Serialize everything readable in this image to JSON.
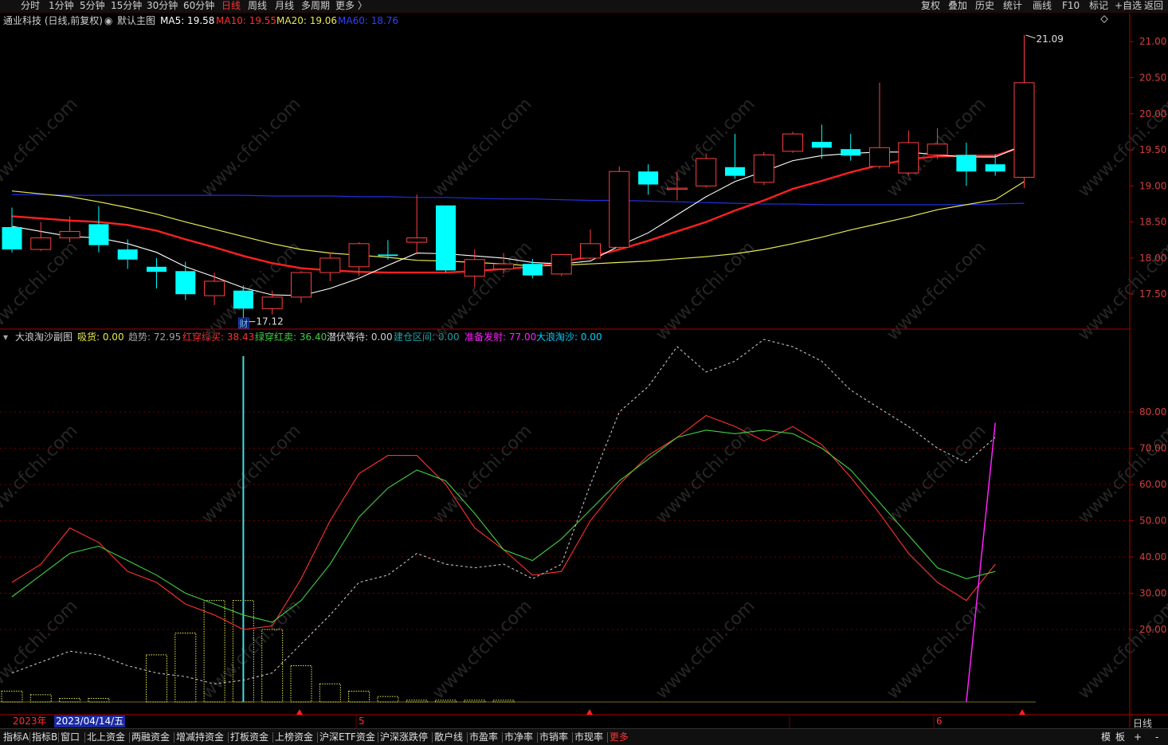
{
  "topbar": {
    "periods": [
      "分时",
      "1分钟",
      "5分钟",
      "15分钟",
      "30分钟",
      "60分钟",
      "日线",
      "周线",
      "月线",
      "多周期",
      "更多 〉"
    ],
    "active_period": "日线",
    "tools": [
      "复权",
      "叠加",
      "历史",
      "统计",
      "画线",
      "F10",
      "标记",
      "+自选",
      "返回"
    ]
  },
  "main_info": {
    "stock": "通业科技 (日线,前复权)",
    "indicator": "默认主图",
    "ma5": "MA5: 19.58",
    "ma10": "MA10: 19.55",
    "ma20": "MA20: 19.06",
    "ma60": "MA60: 18.76"
  },
  "sub_info": {
    "name": "大浪淘沙副图",
    "xihuo": "吸货: 0.00",
    "qushi": "趋势: 72.95",
    "hongchuan": "红穿绿买: 38.43",
    "lvchuan": "绿穿红卖: 36.40",
    "qianfu": "潜伏等待: 0.00",
    "jiancang": "建仓区间: 0.00",
    "zhunbei": "准备发射: 77.00",
    "dalang": "大浪淘沙: 0.00"
  },
  "colors": {
    "up": "#ff4040",
    "down": "#00ffff",
    "ma5": "#ffffff",
    "ma10": "#ff2020",
    "ma20": "#e8e850",
    "ma60": "#2030e0",
    "axis": "#b00000"
  },
  "price_axis": [
    "21.00",
    "20.50",
    "20.00",
    "19.50",
    "19.00",
    "18.50",
    "18.00",
    "17.50"
  ],
  "sub_axis": [
    "80.00",
    "70.00",
    "60.00",
    "50.00",
    "40.00",
    "30.00",
    "20.00"
  ],
  "annotations": {
    "high": "21.09",
    "low": "17.12",
    "cai": "财"
  },
  "date_bar": {
    "year": "2023年",
    "cursor_date": "2023/04/14/五",
    "month5": "5",
    "month6": "6"
  },
  "axis_label": "日线",
  "bottom_tabs": [
    "指标A",
    "指标B",
    "窗口",
    "北上资金",
    "两融资金",
    "增减持资金",
    "打板资金",
    "上榜资金",
    "沪深ETF资金",
    "沪深涨跌停",
    "散户线",
    "市盈率",
    "市净率",
    "市销率",
    "市现率",
    "更多"
  ],
  "bottom_right": [
    "模",
    "板",
    "+",
    "-"
  ],
  "watermark": "www.cfchi.com",
  "chart_data": [
    {
      "type": "candlestick",
      "title": "通业科技 (日线,前复权)",
      "ylim": [
        17.05,
        21.3
      ],
      "candles": [
        {
          "o": 18.43,
          "c": 18.12,
          "h": 18.7,
          "l": 18.08
        },
        {
          "o": 18.12,
          "c": 18.28,
          "h": 18.5,
          "l": 18.1
        },
        {
          "o": 18.28,
          "c": 18.37,
          "h": 18.58,
          "l": 18.22
        },
        {
          "o": 18.47,
          "c": 18.18,
          "h": 18.72,
          "l": 18.08
        },
        {
          "o": 18.12,
          "c": 17.98,
          "h": 18.26,
          "l": 17.85
        },
        {
          "o": 17.88,
          "c": 17.81,
          "h": 18.0,
          "l": 17.58
        },
        {
          "o": 17.82,
          "c": 17.5,
          "h": 17.95,
          "l": 17.42
        },
        {
          "o": 17.48,
          "c": 17.68,
          "h": 17.8,
          "l": 17.35
        },
        {
          "o": 17.55,
          "c": 17.3,
          "h": 17.62,
          "l": 17.12
        },
        {
          "o": 17.3,
          "c": 17.46,
          "h": 17.55,
          "l": 17.22
        },
        {
          "o": 17.46,
          "c": 17.8,
          "h": 17.82,
          "l": 17.38
        },
        {
          "o": 17.8,
          "c": 18.0,
          "h": 18.08,
          "l": 17.68
        },
        {
          "o": 17.88,
          "c": 18.2,
          "h": 18.22,
          "l": 17.75
        },
        {
          "o": 18.05,
          "c": 18.03,
          "h": 18.25,
          "l": 17.98
        },
        {
          "o": 18.22,
          "c": 18.28,
          "h": 18.88,
          "l": 18.05
        },
        {
          "o": 18.73,
          "c": 17.83,
          "h": 18.73,
          "l": 17.8
        },
        {
          "o": 17.75,
          "c": 17.98,
          "h": 18.12,
          "l": 17.6
        },
        {
          "o": 17.85,
          "c": 17.92,
          "h": 18.07,
          "l": 17.78
        },
        {
          "o": 17.92,
          "c": 17.76,
          "h": 17.99,
          "l": 17.72
        },
        {
          "o": 17.78,
          "c": 18.05,
          "h": 18.06,
          "l": 17.75
        },
        {
          "o": 18.0,
          "c": 18.2,
          "h": 18.4,
          "l": 17.98
        },
        {
          "o": 18.15,
          "c": 19.2,
          "h": 19.27,
          "l": 18.13
        },
        {
          "o": 19.2,
          "c": 19.02,
          "h": 19.3,
          "l": 18.88
        },
        {
          "o": 18.97,
          "c": 18.97,
          "h": 19.2,
          "l": 18.8
        },
        {
          "o": 19.0,
          "c": 19.38,
          "h": 19.45,
          "l": 18.98
        },
        {
          "o": 19.26,
          "c": 19.14,
          "h": 19.72,
          "l": 19.1
        },
        {
          "o": 19.05,
          "c": 19.43,
          "h": 19.47,
          "l": 19.01
        },
        {
          "o": 19.48,
          "c": 19.72,
          "h": 19.75,
          "l": 19.46
        },
        {
          "o": 19.61,
          "c": 19.53,
          "h": 19.85,
          "l": 19.38
        },
        {
          "o": 19.51,
          "c": 19.42,
          "h": 19.72,
          "l": 19.35
        },
        {
          "o": 19.27,
          "c": 19.53,
          "h": 20.43,
          "l": 19.24
        },
        {
          "o": 19.18,
          "c": 19.6,
          "h": 19.77,
          "l": 19.15
        },
        {
          "o": 19.43,
          "c": 19.58,
          "h": 19.8,
          "l": 19.37
        },
        {
          "o": 19.43,
          "c": 19.2,
          "h": 19.6,
          "l": 19.0
        },
        {
          "o": 19.3,
          "c": 19.2,
          "h": 19.44,
          "l": 19.14
        },
        {
          "o": 19.12,
          "c": 20.43,
          "h": 21.09,
          "l": 18.97
        }
      ],
      "ma5": [
        18.44,
        18.37,
        18.3,
        18.28,
        18.2,
        18.08,
        17.88,
        17.74,
        17.59,
        17.49,
        17.48,
        17.58,
        17.72,
        17.9,
        18.07,
        18.06,
        18.03,
        18.0,
        17.94,
        17.92,
        17.96,
        18.17,
        18.35,
        18.6,
        18.85,
        19.06,
        19.2,
        19.35,
        19.42,
        19.45,
        19.47,
        19.47,
        19.43,
        19.4,
        19.4,
        19.57
      ],
      "ma10": [
        18.58,
        18.55,
        18.52,
        18.5,
        18.46,
        18.38,
        18.26,
        18.15,
        18.03,
        17.93,
        17.86,
        17.83,
        17.81,
        17.8,
        17.8,
        17.8,
        17.82,
        17.85,
        17.88,
        17.95,
        18.02,
        18.12,
        18.24,
        18.37,
        18.5,
        18.66,
        18.8,
        18.96,
        19.07,
        19.19,
        19.29,
        19.37,
        19.41,
        19.42,
        19.42,
        19.55
      ],
      "ma20": [
        18.93,
        18.89,
        18.85,
        18.78,
        18.7,
        18.61,
        18.5,
        18.4,
        18.3,
        18.2,
        18.12,
        18.07,
        18.04,
        18.01,
        17.97,
        17.96,
        17.94,
        17.92,
        17.89,
        17.9,
        17.92,
        17.94,
        17.96,
        17.99,
        18.02,
        18.06,
        18.12,
        18.2,
        18.29,
        18.39,
        18.48,
        18.57,
        18.67,
        18.74,
        18.81,
        19.06
      ],
      "ma60": [
        18.88,
        18.88,
        18.87,
        18.87,
        18.87,
        18.87,
        18.87,
        18.87,
        18.87,
        18.86,
        18.86,
        18.86,
        18.85,
        18.85,
        18.84,
        18.84,
        18.83,
        18.82,
        18.82,
        18.81,
        18.8,
        18.8,
        18.79,
        18.78,
        18.77,
        18.76,
        18.75,
        18.75,
        18.74,
        18.74,
        18.74,
        18.74,
        18.74,
        18.74,
        18.75,
        18.76
      ]
    },
    {
      "type": "line",
      "title": "大浪淘沙副图",
      "ylim": [
        0,
        100
      ],
      "series": [
        {
          "name": "红穿绿买",
          "color": "#ff3030",
          "values": [
            33,
            38,
            48,
            44,
            36,
            33,
            27,
            24,
            20,
            21,
            34,
            50,
            63,
            68,
            68,
            60,
            48,
            42,
            35,
            36,
            50,
            60,
            68,
            73,
            79,
            76,
            72,
            76,
            71,
            62,
            52,
            41,
            33,
            28,
            38
          ]
        },
        {
          "name": "绿穿红卖",
          "color": "#40d040",
          "values": [
            29,
            35,
            41,
            43,
            39,
            35,
            30,
            27,
            24,
            22,
            28,
            38,
            51,
            59,
            64,
            61,
            52,
            42,
            39,
            45,
            53,
            61,
            67,
            73,
            75,
            74,
            75,
            74,
            70,
            64,
            55,
            46,
            37,
            34,
            36
          ]
        },
        {
          "name": "趋势",
          "color": "#c0c0c0",
          "values": [
            8,
            11,
            14,
            13,
            10,
            8,
            7,
            5,
            6,
            8,
            16,
            24,
            33,
            35,
            41,
            38,
            37,
            38,
            34,
            38,
            60,
            80,
            87,
            98,
            91,
            94,
            100,
            98,
            94,
            86,
            81,
            76,
            70,
            66,
            73
          ]
        },
        {
          "name": "准备发射",
          "color": "#ff20ff",
          "values": [
            0,
            0,
            0,
            0,
            0,
            0,
            0,
            0,
            0,
            0,
            0,
            0,
            0,
            0,
            0,
            0,
            0,
            0,
            0,
            0,
            0,
            0,
            0,
            0,
            0,
            0,
            0,
            0,
            0,
            0,
            0,
            0,
            0,
            0,
            77
          ]
        },
        {
          "name": "吸货",
          "color": "#e8e850",
          "type": "bar",
          "values": [
            3,
            2,
            1,
            1,
            0,
            13,
            19,
            28,
            28,
            20,
            10,
            5,
            3,
            1.5,
            0.5,
            0.5,
            0.5,
            0.5,
            0,
            0,
            0,
            0,
            0,
            0,
            0,
            0,
            0,
            0,
            0,
            0,
            0,
            0,
            0,
            0,
            0
          ]
        }
      ]
    }
  ]
}
